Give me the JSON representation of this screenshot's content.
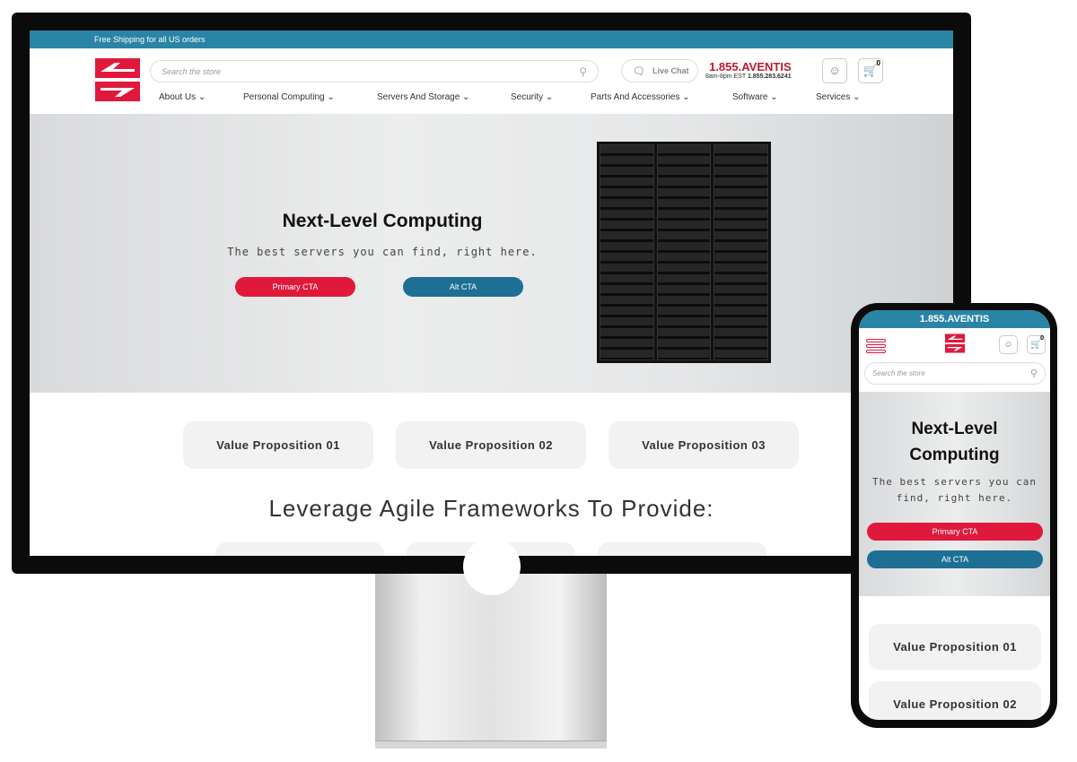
{
  "desktop": {
    "topbar": "Free Shipping for all US orders",
    "search_placeholder": "Search the store",
    "live_chat": "Live Chat",
    "phone_brand": "1.855.AVENTIS",
    "hours": "8am-8pm EST",
    "phone_number": "1.855.283.6241",
    "cart_count": "0",
    "nav": [
      "About Us",
      "Personal Computing",
      "Servers And Storage",
      "Security",
      "Parts And Accessories",
      "Software",
      "Services"
    ],
    "hero_title": "Next-Level Computing",
    "hero_subtitle": "The best servers you can find, right here.",
    "primary_cta": "Primary CTA",
    "alt_cta": "Alt CTA",
    "value_props": [
      "Value Proposition 01",
      "Value Proposition 02",
      "Value Proposition 03"
    ],
    "section_heading": "Leverage Agile Frameworks To Provide:"
  },
  "mobile": {
    "topbar": "1.855.AVENTIS",
    "search_placeholder": "Search the store",
    "cart_count": "0",
    "hero_title": "Next-Level Computing",
    "hero_subtitle": "The best servers you can find, right here.",
    "primary_cta": "Primary CTA",
    "alt_cta": "Alt CTA",
    "value_props": [
      "Value Proposition 01",
      "Value Proposition 02"
    ]
  },
  "colors": {
    "brand_red": "#e0193c",
    "teal": "#2a84a6",
    "alt_cta": "#1d6f93"
  }
}
